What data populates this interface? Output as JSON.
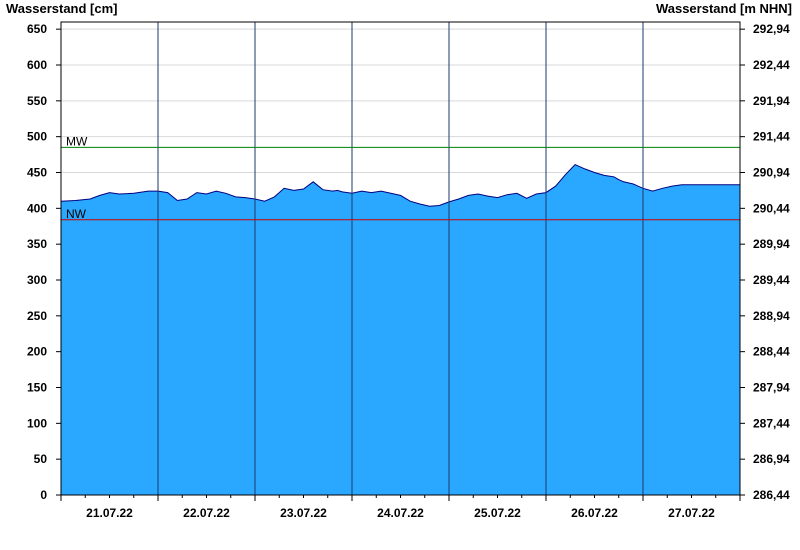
{
  "chart_data": {
    "type": "area",
    "ylabel_left": "Wasserstand [cm]",
    "ylabel_right": "Wasserstand [m NHN]",
    "ylim": [
      0,
      660
    ],
    "yticks_left": [
      0,
      50,
      100,
      150,
      200,
      250,
      300,
      350,
      400,
      450,
      500,
      550,
      600,
      650
    ],
    "yticks_right": [
      "286,44",
      "286,94",
      "287,44",
      "287,94",
      "288,44",
      "288,94",
      "289,44",
      "289,94",
      "290,44",
      "290,94",
      "291,44",
      "291,94",
      "292,44",
      "292,94"
    ],
    "xlim": [
      0,
      7
    ],
    "day_labels": [
      "21.07.22",
      "22.07.22",
      "23.07.22",
      "24.07.22",
      "25.07.22",
      "26.07.22",
      "27.07.22"
    ],
    "day_boundaries": [
      1,
      2,
      3,
      4,
      5,
      6
    ],
    "grid": true,
    "reference_lines": [
      {
        "label": "MW",
        "value": 485,
        "color": "#008000"
      },
      {
        "label": "NW",
        "value": 384,
        "color": "#cc0000"
      }
    ],
    "series": [
      {
        "color": "#2aa8ff",
        "outline": "#000080",
        "x": [
          0,
          0.15,
          0.3,
          0.4,
          0.5,
          0.6,
          0.75,
          0.9,
          1.0,
          1.1,
          1.2,
          1.3,
          1.4,
          1.5,
          1.6,
          1.7,
          1.8,
          1.9,
          2.0,
          2.1,
          2.2,
          2.3,
          2.4,
          2.5,
          2.6,
          2.7,
          2.8,
          2.85,
          2.9,
          3.0,
          3.1,
          3.2,
          3.3,
          3.4,
          3.5,
          3.6,
          3.7,
          3.8,
          3.9,
          4.0,
          4.1,
          4.2,
          4.3,
          4.4,
          4.5,
          4.6,
          4.7,
          4.8,
          4.9,
          5.0,
          5.1,
          5.2,
          5.3,
          5.4,
          5.5,
          5.6,
          5.65,
          5.7,
          5.75,
          5.8,
          5.9,
          6.0,
          6.1,
          6.2,
          6.3,
          6.4,
          6.5,
          6.6,
          6.7,
          6.8,
          6.9,
          7.0
        ],
        "values": [
          410,
          411,
          413,
          418,
          422,
          420,
          421,
          424,
          424,
          422,
          411,
          413,
          422,
          420,
          424,
          421,
          416,
          415,
          413,
          410,
          416,
          428,
          425,
          427,
          437,
          426,
          424,
          425,
          423,
          421,
          424,
          422,
          424,
          421,
          418,
          410,
          406,
          403,
          404,
          409,
          413,
          418,
          420,
          417,
          415,
          419,
          421,
          414,
          420,
          422,
          431,
          447,
          461,
          455,
          450,
          446,
          445,
          444,
          440,
          437,
          434,
          428,
          424,
          428,
          431,
          433,
          433,
          433,
          433,
          433,
          433,
          433
        ]
      }
    ]
  }
}
